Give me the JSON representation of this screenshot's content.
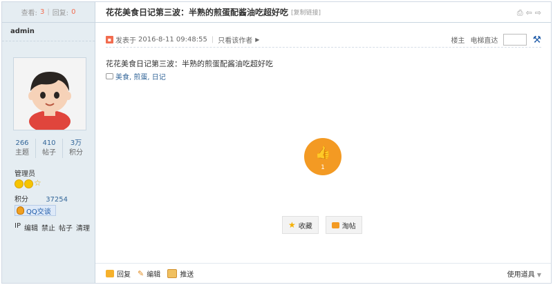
{
  "side": {
    "views_label": "查看:",
    "views": "3",
    "replies_label": "回复:",
    "replies": "0",
    "username": "admin",
    "stats": [
      {
        "value": "266",
        "label": "主题"
      },
      {
        "value": "410",
        "label": "帖子"
      },
      {
        "value": "3万",
        "label": "积分"
      }
    ],
    "group": "管理员",
    "points_label": "积分",
    "points_value": "37254",
    "qq_label": "QQ交谈",
    "admin_links": [
      "IP",
      "编辑",
      "禁止",
      "帖子",
      "清理"
    ]
  },
  "post": {
    "title": "花花美食日记第三波：半熟的煎蛋配酱油吃超好吃",
    "copy_link": "[复制链接]",
    "posted_prefix": "发表于",
    "posted_time": "2016-8-11 09:48:55",
    "only_author": "只看该作者",
    "floor": "楼主",
    "jump_label": "电梯直达",
    "content": "花花美食日记第三波：半熟的煎蛋配酱油吃超好吃",
    "tags": "美食, 煎蛋, 日记",
    "like_count": "1",
    "favorite_label": "收藏",
    "share_label": "淘帖"
  },
  "footer": {
    "reply": "回复",
    "edit": "编辑",
    "push": "推送",
    "tools": "使用道具"
  },
  "colors": {
    "accent_orange": "#f39a23",
    "link_blue": "#336699",
    "side_bg": "#e5edf2"
  }
}
